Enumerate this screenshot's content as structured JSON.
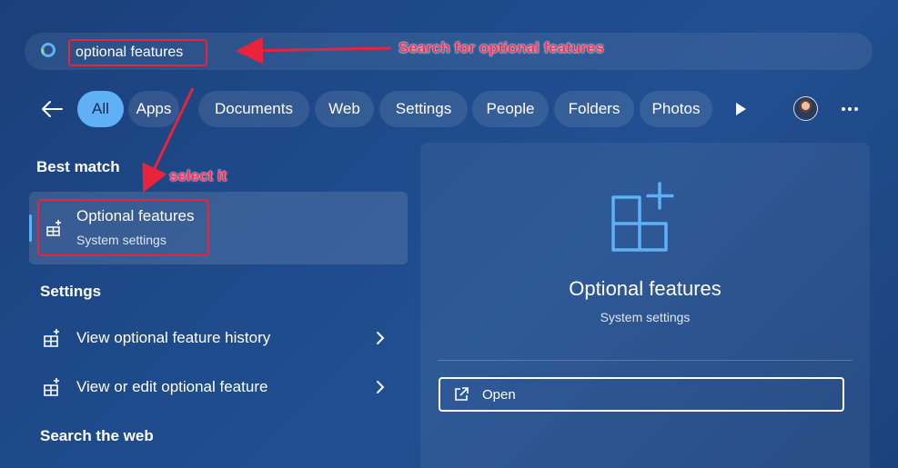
{
  "search": {
    "query": "optional features",
    "annotation": "Search for optional features"
  },
  "filters": {
    "back_icon": "arrow-left-icon",
    "chips": [
      {
        "label": "All",
        "active": true
      },
      {
        "label": "Apps",
        "active": false
      },
      {
        "label": "Documents",
        "active": false
      },
      {
        "label": "Web",
        "active": false
      },
      {
        "label": "Settings",
        "active": false
      },
      {
        "label": "People",
        "active": false
      },
      {
        "label": "Folders",
        "active": false
      },
      {
        "label": "Photos",
        "active": false
      }
    ],
    "more_icon": "ellipsis-icon",
    "next_icon": "play-icon"
  },
  "results": {
    "best_match_heading": "Best match",
    "select_annotation": "select it",
    "best_match": {
      "title": "Optional features",
      "subtitle": "System settings"
    },
    "settings_heading": "Settings",
    "settings_items": [
      {
        "label": "View optional feature history"
      },
      {
        "label": "View or edit optional feature"
      }
    ],
    "web_heading": "Search the web"
  },
  "preview": {
    "title": "Optional features",
    "subtitle": "System settings",
    "open_label": "Open"
  },
  "colors": {
    "accent": "#5fb0f5",
    "annotation": "#ff2e55",
    "highlight_box": "#e8233b"
  }
}
